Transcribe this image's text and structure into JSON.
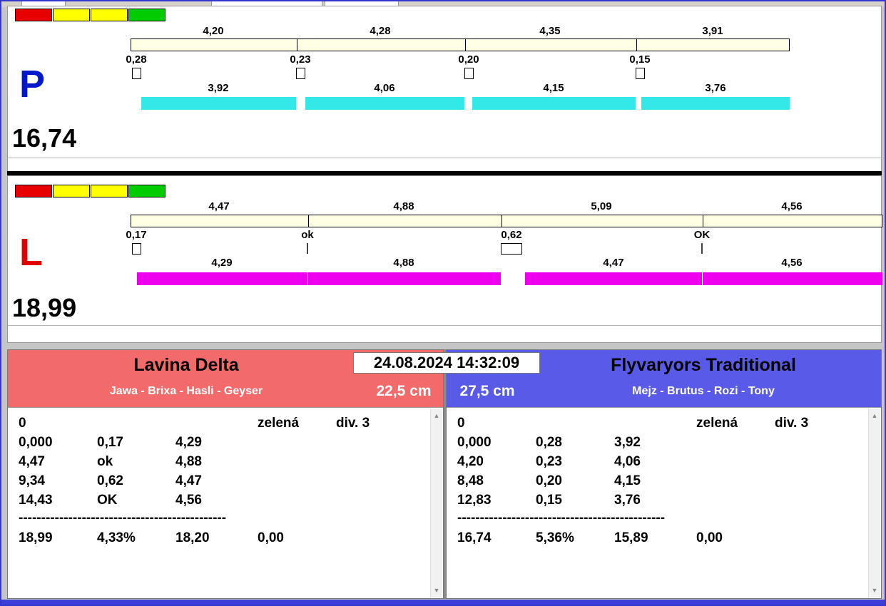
{
  "datetime": "24.08.2024 14:32:09",
  "colors": {
    "frame_border": "#3535cf",
    "cream_bar": "#ffffe4",
    "cyan_bar": "#35e8e8",
    "magenta_bar": "#ee00ee",
    "light_red": "#e80000",
    "light_yellow": "#ffff00",
    "light_green": "#00cc00",
    "left_header": "#f26a6a",
    "right_header": "#5a5ae8",
    "lane_p_letter": "#0018cc",
    "lane_l_letter": "#e00000"
  },
  "lane_p": {
    "label": "P",
    "total": "16,74",
    "lights": [
      "red",
      "yellow",
      "yellow",
      "green"
    ],
    "splits": [
      "4,20",
      "4,28",
      "4,35",
      "3,91"
    ],
    "changes": [
      "0,28",
      "0,23",
      "0,20",
      "0,15"
    ],
    "dog_times": [
      "3,92",
      "4,06",
      "4,15",
      "3,76"
    ]
  },
  "lane_l": {
    "label": "L",
    "total": "18,99",
    "lights": [
      "red",
      "yellow",
      "yellow",
      "green"
    ],
    "splits": [
      "4,47",
      "4,88",
      "5,09",
      "4,56"
    ],
    "changes": [
      "0,17",
      "ok",
      "0,62",
      "OK"
    ],
    "dog_times": [
      "4,29",
      "4,88",
      "4,47",
      "4,56"
    ]
  },
  "left_team": {
    "name": "Lavina Delta",
    "dogs": "Jawa - Brixa - Hasli - Geyser",
    "jump_height": "22,5 cm",
    "rows": [
      [
        "0",
        "",
        "",
        "zelená",
        "div. 3"
      ],
      [
        "0,000",
        "0,17",
        "4,29",
        "",
        ""
      ],
      [
        "4,47",
        "ok",
        "4,88",
        "",
        ""
      ],
      [
        "9,34",
        "0,62",
        "4,47",
        "",
        ""
      ],
      [
        "14,43",
        "OK",
        "4,56",
        "",
        ""
      ]
    ],
    "divider": "----------------------------------------------",
    "totals": [
      "18,99",
      "4,33%",
      "18,20",
      "0,00"
    ]
  },
  "right_team": {
    "name": "Flyvaryors Traditional",
    "dogs": "Mejz - Brutus - Rozi - Tony",
    "jump_height": "27,5 cm",
    "rows": [
      [
        "0",
        "",
        "",
        "zelená",
        "div. 3"
      ],
      [
        "0,000",
        "0,28",
        "3,92",
        "",
        ""
      ],
      [
        "4,20",
        "0,23",
        "4,06",
        "",
        ""
      ],
      [
        "8,48",
        "0,20",
        "4,15",
        "",
        ""
      ],
      [
        "12,83",
        "0,15",
        "3,76",
        "",
        ""
      ]
    ],
    "divider": "----------------------------------------------",
    "totals": [
      "16,74",
      "5,36%",
      "15,89",
      "0,00"
    ]
  },
  "scroll": {
    "up": "▲",
    "down": "▼"
  }
}
